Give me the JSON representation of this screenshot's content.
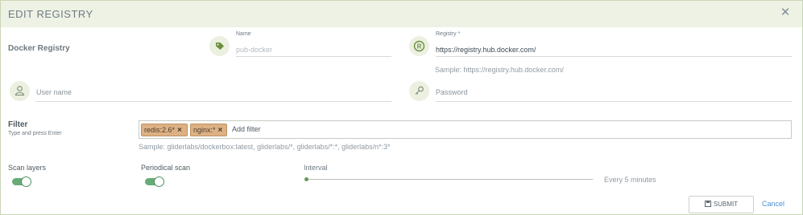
{
  "dialog": {
    "title": "EDIT REGISTRY",
    "close_icon": "close-icon"
  },
  "registry_section": {
    "label": "Docker Registry"
  },
  "name_field": {
    "label": "Name",
    "value": "",
    "placeholder": "pub-docker",
    "icon": "tag-icon"
  },
  "registry_field": {
    "label": "Registry *",
    "value": "https://registry.hub.docker.com/",
    "sample": "Sample: https://registry.hub.docker.com/",
    "icon": "registered-icon"
  },
  "username_field": {
    "placeholder": "User name",
    "value": "",
    "icon": "user-icon"
  },
  "password_field": {
    "placeholder": "Password",
    "value": "",
    "icon": "key-icon"
  },
  "filter": {
    "label": "Filter",
    "hint": "Type and press Enter",
    "tags": [
      "redis:2.6*",
      "nginx:*"
    ],
    "tag_remove": "×",
    "input_placeholder": "Add filter",
    "sample": "Sample: gliderlabs/dockerbox:latest, gliderlabs/*, gliderlabs/*:*, gliderlabs/n*:3*"
  },
  "scan_layers": {
    "label": "Scan layers",
    "on": true
  },
  "periodical_scan": {
    "label": "Periodical scan",
    "on": true
  },
  "interval": {
    "label": "Interval",
    "value_text": "Every 5 minutes",
    "level": 0
  },
  "actions": {
    "submit_label": "SUBMIT",
    "cancel_label": "Cancel"
  },
  "colors": {
    "accent": "#67ab77",
    "header_bg": "#edf2e4",
    "tag_bg": "#ddb184",
    "link": "#4a91d2"
  }
}
